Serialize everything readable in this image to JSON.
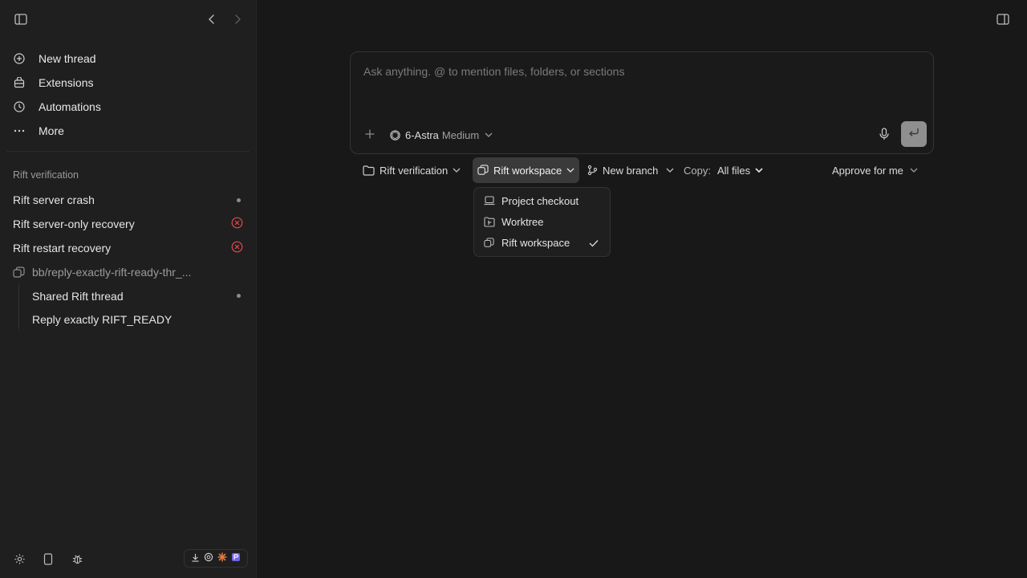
{
  "sidebar": {
    "nav": [
      {
        "label": "New thread",
        "icon": "plus-circle-icon"
      },
      {
        "label": "Extensions",
        "icon": "extensions-icon"
      },
      {
        "label": "Automations",
        "icon": "clock-icon"
      },
      {
        "label": "More",
        "icon": "more-icon"
      }
    ],
    "section_title": "Rift verification",
    "threads": [
      {
        "label": "Rift server crash",
        "status": "dot"
      },
      {
        "label": "Rift server-only recovery",
        "status": "error"
      },
      {
        "label": "Rift restart recovery",
        "status": "error"
      }
    ],
    "group": {
      "label": "bb/reply-exactly-rift-ready-thr_...",
      "children": [
        {
          "label": "Shared Rift thread",
          "status": "dot"
        },
        {
          "label": "Reply exactly RIFT_READY",
          "status": ""
        }
      ]
    }
  },
  "composer": {
    "placeholder": "Ask anything. @ to mention files, folders, or sections",
    "model_name": "6-Astra",
    "model_effort": "Medium"
  },
  "toolbar": {
    "project": "Rift verification",
    "environment": "Rift workspace",
    "branch": "New branch",
    "copy_label": "Copy:",
    "copy_value": "All files",
    "approval": "Approve for me"
  },
  "environment_menu": {
    "items": [
      {
        "label": "Project checkout",
        "selected": false
      },
      {
        "label": "Worktree",
        "selected": false
      },
      {
        "label": "Rift workspace",
        "selected": true
      }
    ]
  },
  "colors": {
    "background": "#181818",
    "sidebar": "#1f1f1f",
    "error": "#e5484d",
    "send_button": "#8f8f8f"
  }
}
